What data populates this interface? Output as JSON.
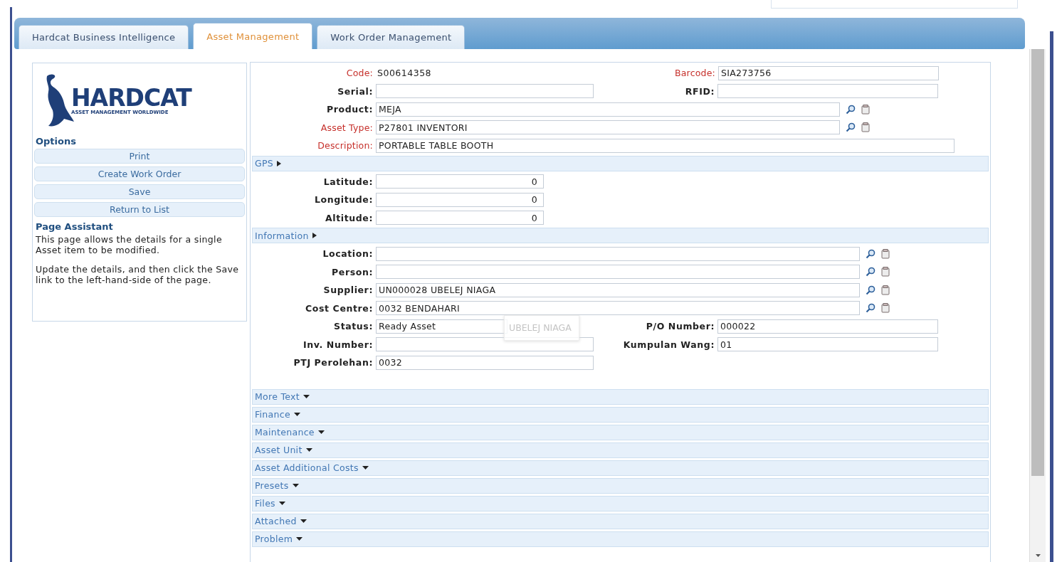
{
  "tabs": [
    {
      "label": "Hardcat Business Intelligence",
      "selected": false
    },
    {
      "label": "Asset Management",
      "selected": true
    },
    {
      "label": "Work Order Management",
      "selected": false
    }
  ],
  "logo": {
    "text": "HARDCAT",
    "tagline": "ASSET MANAGEMENT WORLDWIDE"
  },
  "sidebar": {
    "options_title": "Options",
    "buttons": [
      "Print",
      "Create Work Order",
      "Save",
      "Return to List"
    ],
    "assistant_title": "Page Assistant",
    "assistant_text": [
      "This page allows the details for a single Asset item to be modified.",
      "Update the details, and then click the Save link to the left-hand-side of the page."
    ]
  },
  "header_rows": [
    {
      "kind": "pair",
      "fields": [
        {
          "label": "Code:",
          "required": true,
          "kind": "text",
          "value": "S00614358"
        },
        {
          "label": "Barcode:",
          "required": true,
          "kind": "input",
          "value": "SIA273756"
        }
      ]
    },
    {
      "kind": "pair",
      "fields": [
        {
          "label": "Serial:",
          "required": false,
          "kind": "input"
        },
        {
          "label": "RFID:",
          "required": false,
          "kind": "input"
        }
      ]
    },
    {
      "kind": "lookup",
      "fields": [
        {
          "label": "Product:",
          "required": false,
          "kind": "input",
          "value": "MEJA"
        }
      ]
    },
    {
      "kind": "lookup",
      "fields": [
        {
          "label": "Asset Type:",
          "required": true,
          "kind": "input",
          "value": "P27801 INVENTORI"
        }
      ]
    },
    {
      "kind": "wide",
      "fields": [
        {
          "label": "Description:",
          "required": true,
          "kind": "input",
          "value": "PORTABLE TABLE BOOTH"
        }
      ]
    }
  ],
  "sections": [
    {
      "title": "GPS",
      "expanded": true,
      "rows": [
        {
          "kind": "short",
          "fields": [
            {
              "label": "Latitude:",
              "required": false,
              "kind": "input",
              "value": "0"
            }
          ]
        },
        {
          "kind": "short",
          "fields": [
            {
              "label": "Longitude:",
              "required": false,
              "kind": "input",
              "value": "0"
            }
          ]
        },
        {
          "kind": "short",
          "fields": [
            {
              "label": "Altitude:",
              "required": false,
              "kind": "input",
              "value": "0"
            }
          ]
        }
      ]
    },
    {
      "title": "Information",
      "expanded": true,
      "rows": [
        {
          "kind": "lookup",
          "fields": [
            {
              "label": "Location:",
              "required": false,
              "kind": "input"
            }
          ]
        },
        {
          "kind": "lookup",
          "fields": [
            {
              "label": "Person:",
              "required": false,
              "kind": "input"
            }
          ]
        },
        {
          "kind": "lookup",
          "fields": [
            {
              "label": "Supplier:",
              "required": false,
              "kind": "input",
              "value": "UN000028 UBELEJ NIAGA"
            }
          ]
        },
        {
          "kind": "lookup",
          "fields": [
            {
              "label": "Cost Centre:",
              "required": false,
              "kind": "input",
              "value": "0032 BENDAHARI"
            }
          ]
        },
        {
          "kind": "pair",
          "fields": [
            {
              "label": "Status:",
              "required": false,
              "kind": "select",
              "value": "Ready Asset",
              "ghost_text": "UBELEJ NIAGA"
            },
            {
              "label": "P/O Number:",
              "required": false,
              "kind": "input",
              "value": "000022"
            }
          ]
        },
        {
          "kind": "pair",
          "fields": [
            {
              "label": "Inv. Number:",
              "required": false,
              "kind": "input"
            },
            {
              "label": "Kumpulan Wang:",
              "required": false,
              "kind": "input",
              "value": "01"
            }
          ]
        },
        {
          "kind": "pair",
          "fields": [
            {
              "label": "PTJ Perolehan:",
              "required": false,
              "kind": "input",
              "value": "0032"
            }
          ]
        }
      ]
    },
    {
      "title": "More Text",
      "expanded": false
    },
    {
      "title": "Finance",
      "expanded": false
    },
    {
      "title": "Maintenance",
      "expanded": false
    },
    {
      "title": "Asset Unit",
      "expanded": false
    },
    {
      "title": "Asset Additional Costs",
      "expanded": false
    },
    {
      "title": "Presets",
      "expanded": false
    },
    {
      "title": "Files",
      "expanded": false
    },
    {
      "title": "Attached",
      "expanded": false
    },
    {
      "title": "Problem",
      "expanded": false
    }
  ]
}
